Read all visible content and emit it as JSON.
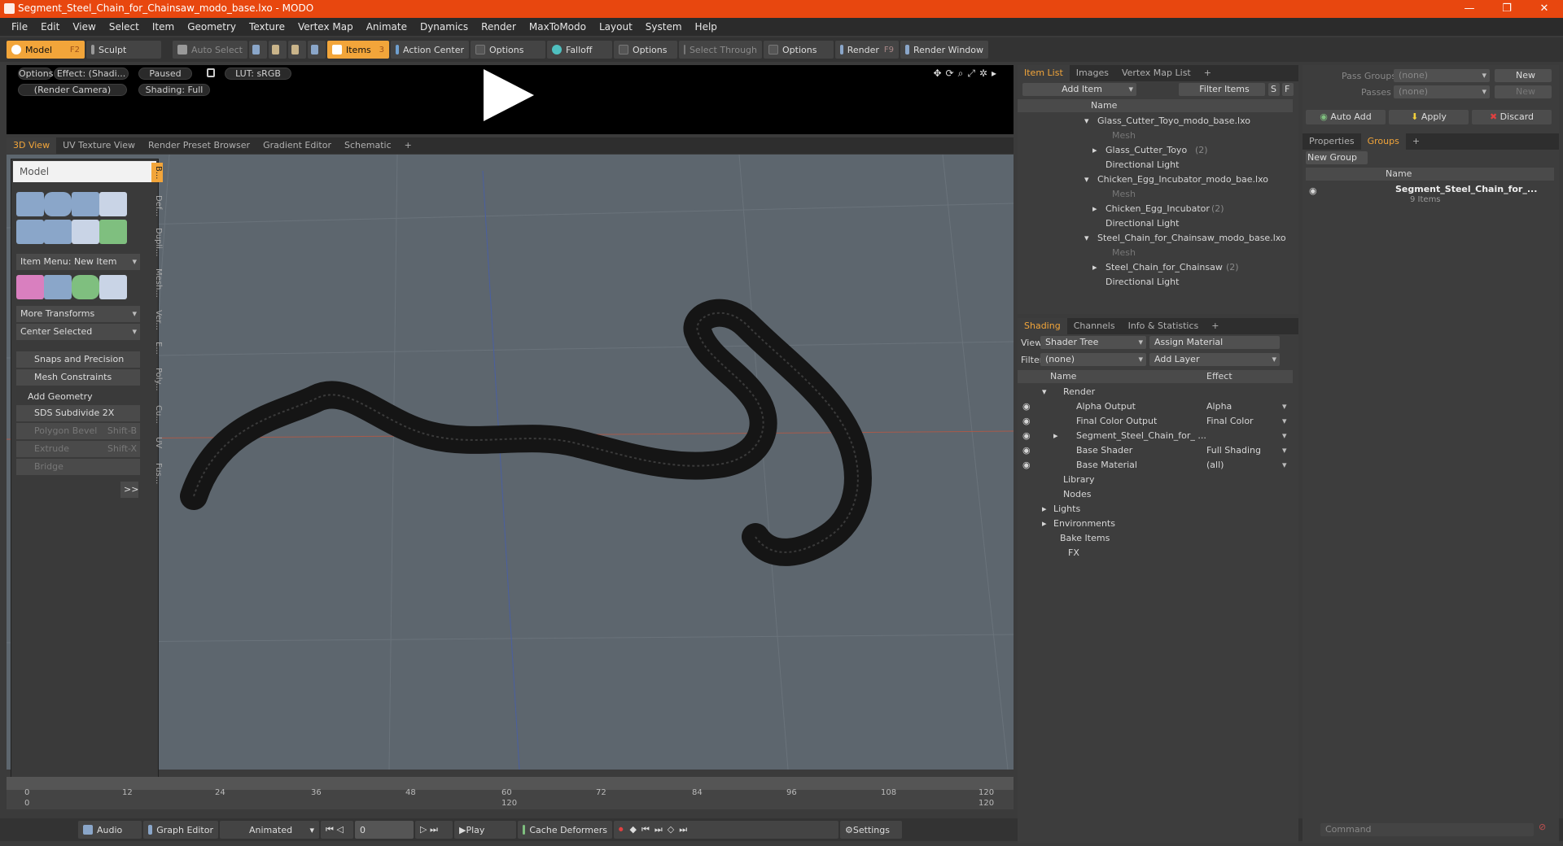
{
  "window": {
    "title": "Segment_Steel_Chain_for_Chainsaw_modo_base.lxo - MODO",
    "minimize": "—",
    "maximize": "❐",
    "close": "✕"
  },
  "menu": [
    "File",
    "Edit",
    "View",
    "Select",
    "Item",
    "Geometry",
    "Texture",
    "Vertex Map",
    "Animate",
    "Dynamics",
    "Render",
    "MaxToModo",
    "Layout",
    "System",
    "Help"
  ],
  "toolbar": {
    "model": "Model",
    "model_key": "F2",
    "sculpt": "Sculpt",
    "auto_select": "Auto Select",
    "items": "Items",
    "items_key": "3",
    "action_center": "Action Center",
    "options1": "Options",
    "falloff": "Falloff",
    "options2": "Options",
    "select_through": "Select Through",
    "options3": "Options",
    "render": "Render",
    "render_key": "F9",
    "render_window": "Render Window"
  },
  "preview": {
    "options": "Options",
    "effect": "Effect: (Shadi...",
    "paused": "Paused",
    "lut": "LUT: sRGB",
    "camera": "(Render Camera)",
    "shading": "Shading: Full"
  },
  "view_tabs": [
    "3D View",
    "UV Texture View",
    "Render Preset Browser",
    "Gradient Editor",
    "Schematic"
  ],
  "tool_panel": {
    "title": "Model",
    "item_menu": "Item Menu: New Item",
    "more_transforms": "More Transforms",
    "center_selected": "Center Selected",
    "snaps": "Snaps and Precision",
    "mesh_constraints": "Mesh Constraints",
    "add_geometry": "Add Geometry",
    "sds": "SDS Subdivide 2X",
    "polygon_bevel": "Polygon Bevel",
    "polygon_bevel_key": "Shift-B",
    "extrude": "Extrude",
    "extrude_key": "Shift-X",
    "bridge": "Bridge",
    "more": ">>",
    "vtabs": [
      "B...",
      "Def...",
      "Dupli...",
      "Mesh...",
      "Ver...",
      "E...",
      "Poly...",
      "Cu...",
      "UV",
      "Fus..."
    ]
  },
  "timeline": {
    "ticks_top": [
      "0",
      "12",
      "24",
      "36",
      "48",
      "60",
      "72",
      "84",
      "96",
      "108",
      "120"
    ],
    "ticks_bottom": [
      "0",
      "120",
      "120"
    ]
  },
  "bottom": {
    "audio": "Audio",
    "graph_editor": "Graph Editor",
    "animated": "Animated",
    "frame": "0",
    "play": "Play",
    "cache": "Cache Deformers",
    "settings": "Settings"
  },
  "item_list": {
    "tabs": [
      "Item List",
      "Images",
      "Vertex Map List"
    ],
    "add_item": "Add Item",
    "filter_items": "Filter Items",
    "s": "S",
    "f": "F",
    "name_header": "Name",
    "rows": [
      {
        "label": "Glass_Cutter_Toyo_modo_base.lxo",
        "count": "",
        "indent": 1,
        "dim": false
      },
      {
        "label": "Mesh",
        "count": "",
        "indent": 3,
        "dim": true
      },
      {
        "label": "Glass_Cutter_Toyo",
        "count": "(2)",
        "indent": 2,
        "dim": false
      },
      {
        "label": "Directional Light",
        "count": "",
        "indent": 2,
        "dim": false
      },
      {
        "label": "Chicken_Egg_Incubator_modo_bae.lxo",
        "count": "",
        "indent": 1,
        "dim": false
      },
      {
        "label": "Mesh",
        "count": "",
        "indent": 3,
        "dim": true
      },
      {
        "label": "Chicken_Egg_Incubator",
        "count": "(2)",
        "indent": 2,
        "dim": false
      },
      {
        "label": "Directional Light",
        "count": "",
        "indent": 2,
        "dim": false
      },
      {
        "label": "Steel_Chain_for_Chainsaw_modo_base.lxo",
        "count": "",
        "indent": 1,
        "dim": false
      },
      {
        "label": "Mesh",
        "count": "",
        "indent": 3,
        "dim": true
      },
      {
        "label": "Steel_Chain_for_Chainsaw",
        "count": "(2)",
        "indent": 2,
        "dim": false
      },
      {
        "label": "Directional Light",
        "count": "",
        "indent": 2,
        "dim": false
      }
    ]
  },
  "shading": {
    "tabs": [
      "Shading",
      "Channels",
      "Info & Statistics"
    ],
    "view_label": "View",
    "view_value": "Shader Tree",
    "assign_material": "Assign Material",
    "filter_label": "Filter",
    "filter_value": "(none)",
    "add_layer": "Add Layer",
    "name_header": "Name",
    "effect_header": "Effect",
    "rows": [
      {
        "name": "Render",
        "effect": "",
        "indent": 0
      },
      {
        "name": "Alpha Output",
        "effect": "Alpha",
        "indent": 1
      },
      {
        "name": "Final Color Output",
        "effect": "Final Color",
        "indent": 1
      },
      {
        "name": "Segment_Steel_Chain_for_ ...",
        "effect": "",
        "indent": 1
      },
      {
        "name": "Base Shader",
        "effect": "Full Shading",
        "indent": 1
      },
      {
        "name": "Base Material",
        "effect": "(all)",
        "indent": 1
      },
      {
        "name": "Library",
        "effect": "",
        "indent": 0
      },
      {
        "name": "Nodes",
        "effect": "",
        "indent": 0
      },
      {
        "name": "Lights",
        "effect": "",
        "indent": -1
      },
      {
        "name": "Environments",
        "effect": "",
        "indent": -1
      },
      {
        "name": "Bake Items",
        "effect": "",
        "indent": -1
      },
      {
        "name": "FX",
        "effect": "",
        "indent": 0
      }
    ]
  },
  "right_panel": {
    "pass_groups": "Pass Groups",
    "passes": "Passes",
    "none1": "(none)",
    "none2": "(none)",
    "new1": "New",
    "new2": "New",
    "auto_add": "Auto Add",
    "apply": "Apply",
    "discard": "Discard",
    "tabs": [
      "Properties",
      "Groups"
    ],
    "new_group": "New Group",
    "name_header": "Name",
    "group_name": "Segment_Steel_Chain_for_...",
    "group_items": "9 Items",
    "command": "Command"
  },
  "colors": {
    "accent": "#f2a53a",
    "titlebar": "#e8470f"
  }
}
